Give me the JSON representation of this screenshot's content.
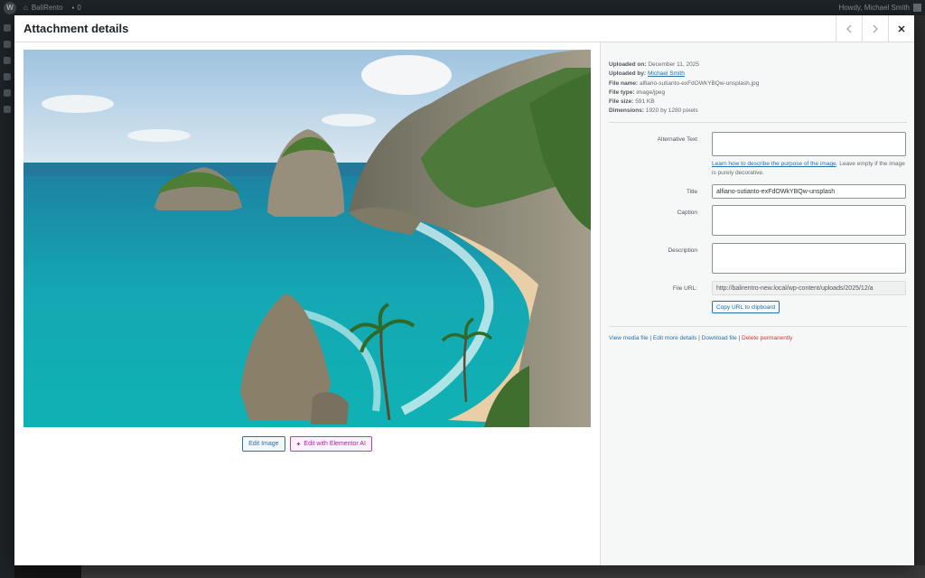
{
  "adminbar": {
    "site_name": "BaliRento",
    "comments_count": "0",
    "howdy": "Howdy, Michael Smith"
  },
  "modal": {
    "title": "Attachment details",
    "prev_icon": "chevron-left-icon",
    "next_icon": "chevron-right-icon",
    "close_icon": "close-icon"
  },
  "image_actions": {
    "edit_image": "Edit Image",
    "edit_ai": "Edit with Elementor AI"
  },
  "file_info": {
    "uploaded_on_label": "Uploaded on:",
    "uploaded_on": "December 11, 2025",
    "uploaded_by_label": "Uploaded by:",
    "uploaded_by": "Michael Smith",
    "file_name_label": "File name:",
    "file_name": "alfiano-sutianto-exFdOWkYBQw-unsplash.jpg",
    "file_type_label": "File type:",
    "file_type": "image/jpeg",
    "file_size_label": "File size:",
    "file_size": "591 KB",
    "dimensions_label": "Dimensions:",
    "dimensions": "1920 by 1280 pixels"
  },
  "fields": {
    "alt_text_label": "Alternative Text",
    "alt_text_value": "",
    "alt_help_link": "Learn how to describe the purpose of the image",
    "alt_help_rest": ". Leave empty if the image is purely decorative.",
    "title_label": "Title",
    "title_value": "alfiano-sutianto-exFdOWkYBQw-unsplash",
    "caption_label": "Caption",
    "caption_value": "",
    "description_label": "Description",
    "description_value": "",
    "file_url_label": "File URL:",
    "file_url_value": "http://balirentro-new.local/wp-content/uploads/2025/12/a",
    "copy_url": "Copy URL to clipboard"
  },
  "links": {
    "view": "View media file",
    "edit": "Edit more details",
    "download": "Download file",
    "delete": "Delete permanently",
    "sep": " | "
  },
  "colors": {
    "accent": "#2271b1",
    "danger": "#d63638",
    "ai": "#b0219f"
  }
}
